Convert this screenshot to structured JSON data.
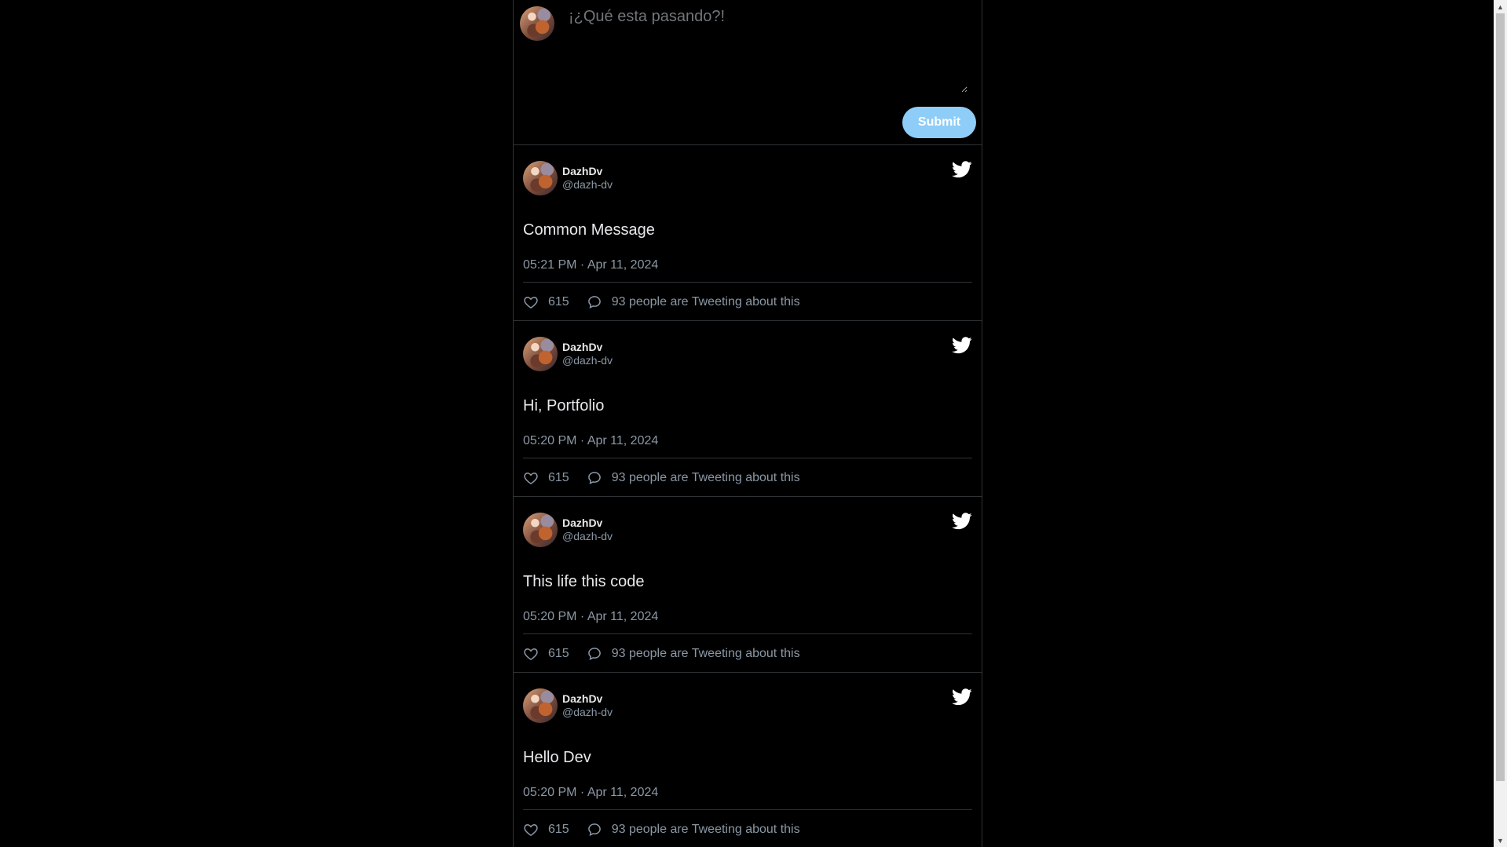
{
  "composer": {
    "placeholder": "¡¿Qué esta pasando?!",
    "submit_label": "Submit"
  },
  "tweets": [
    {
      "name": "DazhDv",
      "handle": "@dazh-dv",
      "text": "Common Message",
      "time": "05:21 PM · Apr 11, 2024",
      "likes": "615",
      "talking": "93 people are Tweeting about this"
    },
    {
      "name": "DazhDv",
      "handle": "@dazh-dv",
      "text": "Hi, Portfolio",
      "time": "05:20 PM · Apr 11, 2024",
      "likes": "615",
      "talking": "93 people are Tweeting about this"
    },
    {
      "name": "DazhDv",
      "handle": "@dazh-dv",
      "text": "This life this code",
      "time": "05:20 PM · Apr 11, 2024",
      "likes": "615",
      "talking": "93 people are Tweeting about this"
    },
    {
      "name": "DazhDv",
      "handle": "@dazh-dv",
      "text": "Hello Dev",
      "time": "05:20 PM · Apr 11, 2024",
      "likes": "615",
      "talking": "93 people are Tweeting about this"
    }
  ],
  "icons": {
    "brand": "twitter-bird-icon",
    "like": "heart-icon",
    "comment": "speech-bubble-icon"
  },
  "colors": {
    "background": "#000000",
    "submit": "#8ecdf8",
    "border": "#2f3336",
    "muted": "#8b98a5"
  }
}
